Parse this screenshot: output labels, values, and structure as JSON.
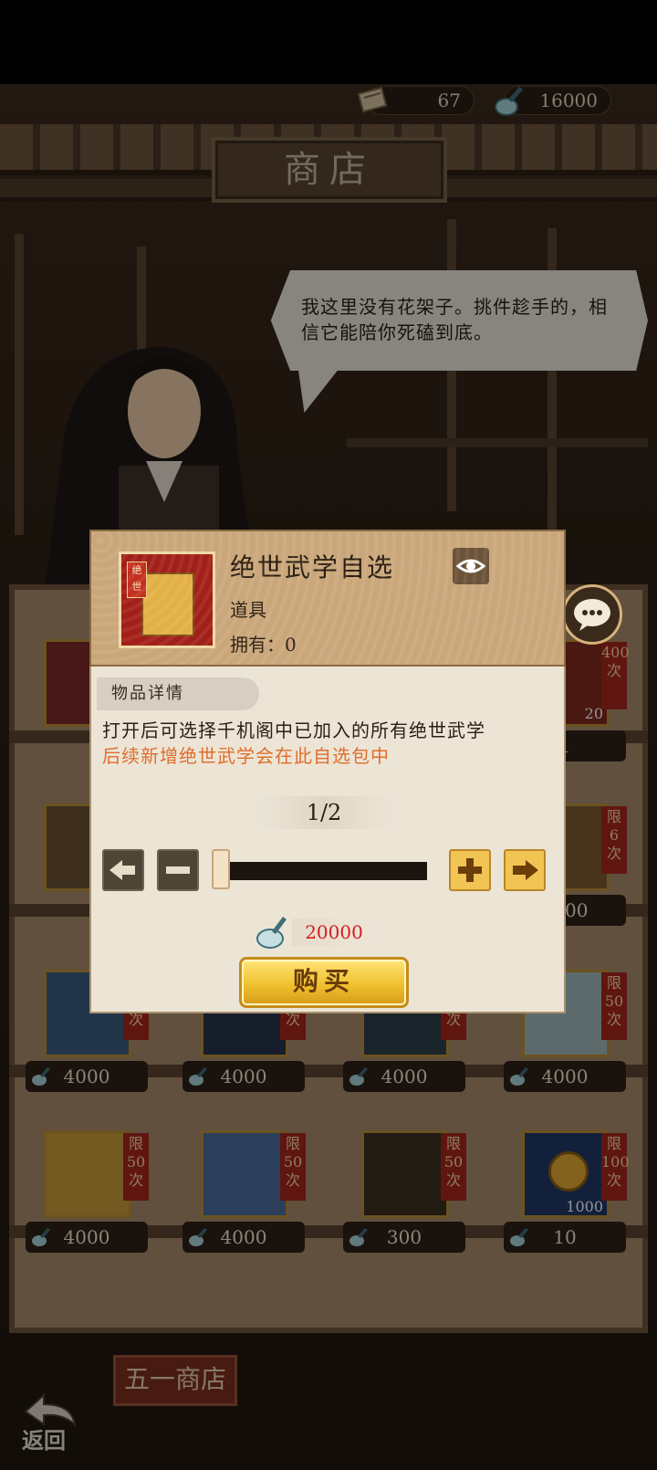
{
  "currency": {
    "scrolls": "67",
    "jade": "16000"
  },
  "shop": {
    "title": "商店",
    "npc_speech": "我这里没有花架子。挑件趁手的，相信它能陪你死磕到底。",
    "bottom_tab": "五一商店",
    "back_label": "返回"
  },
  "grid": {
    "row1": [
      {
        "limit": "",
        "price": "",
        "stock": ""
      },
      {
        "limit": "",
        "price": "",
        "stock": ""
      },
      {
        "limit": "",
        "price": "",
        "stock": ""
      },
      {
        "limit": "400\n次",
        "price": "1",
        "stock": "20"
      }
    ],
    "row2": [
      {
        "limit": "",
        "price": "",
        "stock": ""
      },
      {
        "limit": "",
        "price": "",
        "stock": ""
      },
      {
        "limit": "",
        "price": "",
        "stock": ""
      },
      {
        "limit": "限\n6\n次",
        "price": "4000",
        "stock": ""
      }
    ],
    "row3": [
      {
        "limit": "次",
        "price": "4000"
      },
      {
        "limit": "次",
        "price": "4000"
      },
      {
        "limit": "次",
        "price": "4000"
      },
      {
        "limit": "限\n50\n次",
        "price": "4000"
      }
    ],
    "row4": [
      {
        "limit": "限\n50\n次",
        "price": "4000"
      },
      {
        "limit": "限\n50\n次",
        "price": "4000"
      },
      {
        "limit": "限\n50\n次",
        "price": "300"
      },
      {
        "limit": "限\n100\n次",
        "price": "10",
        "stock": "1000"
      }
    ]
  },
  "modal": {
    "item_name": "绝世武学自选",
    "item_icon_label": "绝世",
    "item_type": "道具",
    "owned": "拥有：0",
    "section_tag": "物品详情",
    "desc_line1": "打开后可选择千机阁中已加入的所有绝世武学",
    "desc_line2": "后续新增绝世武学会在此自选包中",
    "quantity": "1/2",
    "price": "20000",
    "buy_label": "购买",
    "quantity_fill": 0.5
  },
  "colors": {
    "price_red": "#d41e1e",
    "desc_orange": "#e06d2a",
    "buy_gold": "#f0c12e"
  },
  "icons": {
    "scroll": "scroll-icon",
    "jade": "jade-icon",
    "eye": "eye-icon",
    "chat": "chat-bubble-icon",
    "back": "return-arrow-icon"
  }
}
